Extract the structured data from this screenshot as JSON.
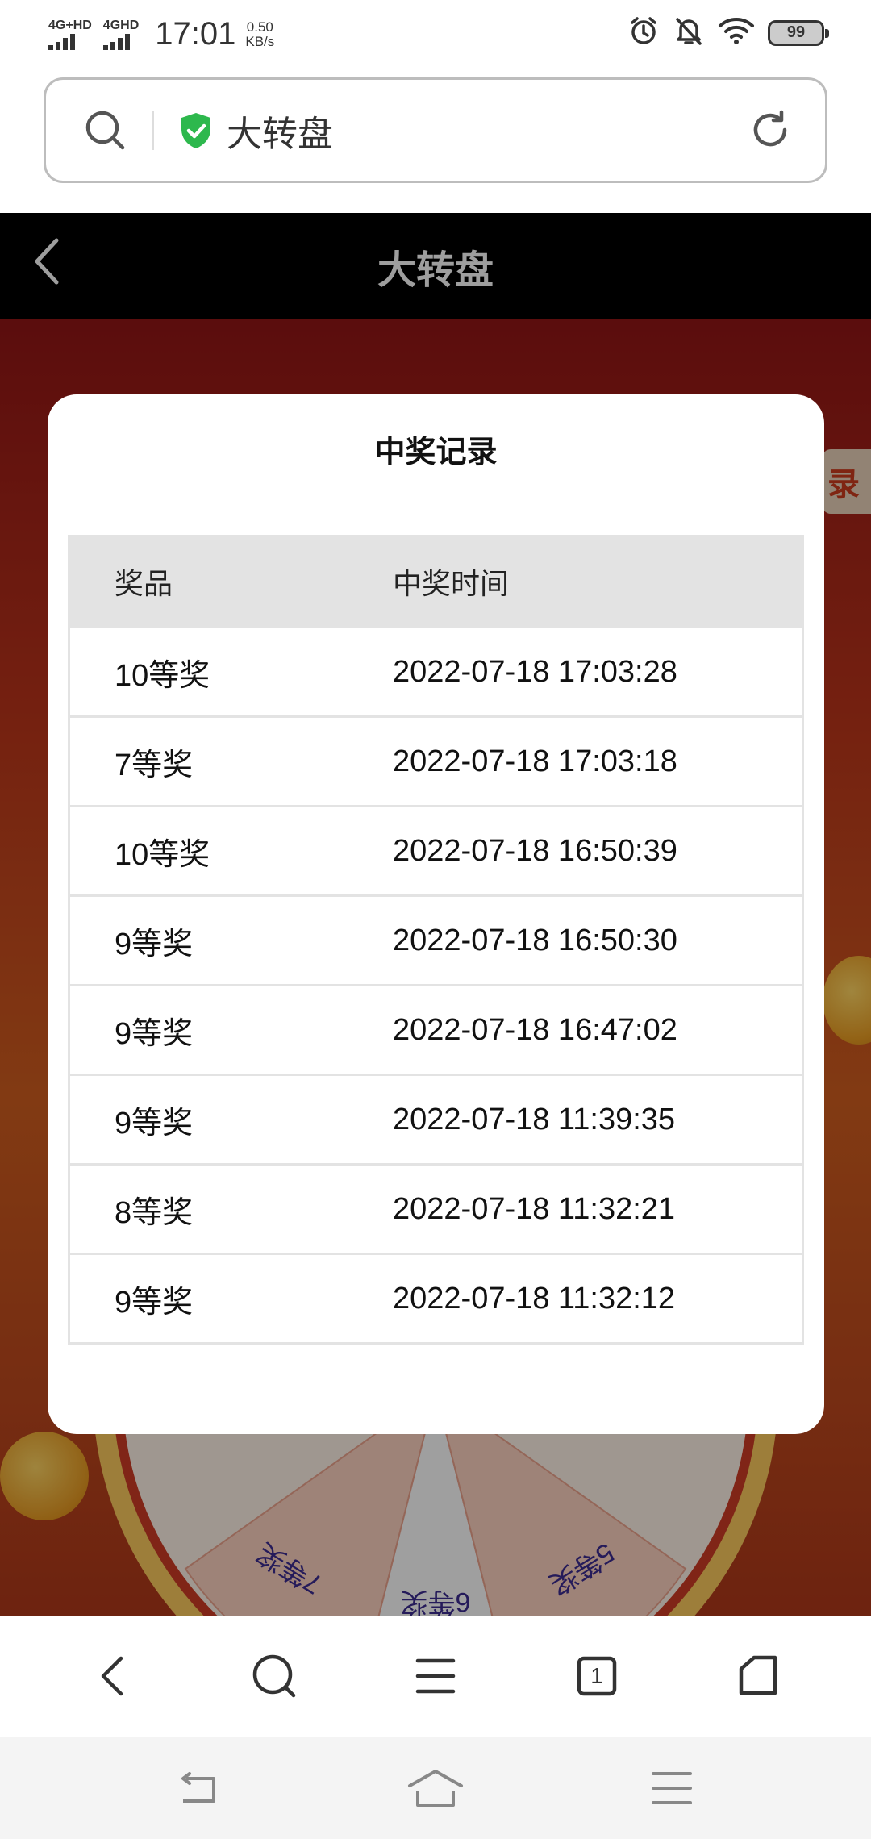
{
  "status_bar": {
    "signal1_label": "4G+HD",
    "signal2_label": "4GHD",
    "time": "17:01",
    "speed_value": "0.50",
    "speed_unit": "KB/s",
    "battery": "99"
  },
  "address_bar": {
    "url_text": "大转盘"
  },
  "header": {
    "title": "大转盘"
  },
  "background": {
    "record_tab_label": "录",
    "wheel_segments": [
      "7等奖",
      "6等奖",
      "5等奖"
    ]
  },
  "modal": {
    "title": "中奖记录",
    "columns": [
      "奖品",
      "中奖时间"
    ],
    "rows": [
      {
        "prize": "10等奖",
        "time": "2022-07-18 17:03:28"
      },
      {
        "prize": "7等奖",
        "time": "2022-07-18 17:03:18"
      },
      {
        "prize": "10等奖",
        "time": "2022-07-18 16:50:39"
      },
      {
        "prize": "9等奖",
        "time": "2022-07-18 16:50:30"
      },
      {
        "prize": "9等奖",
        "time": "2022-07-18 16:47:02"
      },
      {
        "prize": "9等奖",
        "time": "2022-07-18 11:39:35"
      },
      {
        "prize": "8等奖",
        "time": "2022-07-18 11:32:21"
      },
      {
        "prize": "9等奖",
        "time": "2022-07-18 11:32:12"
      }
    ]
  },
  "browser_toolbar": {
    "tab_count": "1"
  },
  "colors": {
    "header_bg": "#000000",
    "shield_green": "#2db84d",
    "page_red": "#b3321a",
    "wheel_text": "#3a2a8a"
  }
}
